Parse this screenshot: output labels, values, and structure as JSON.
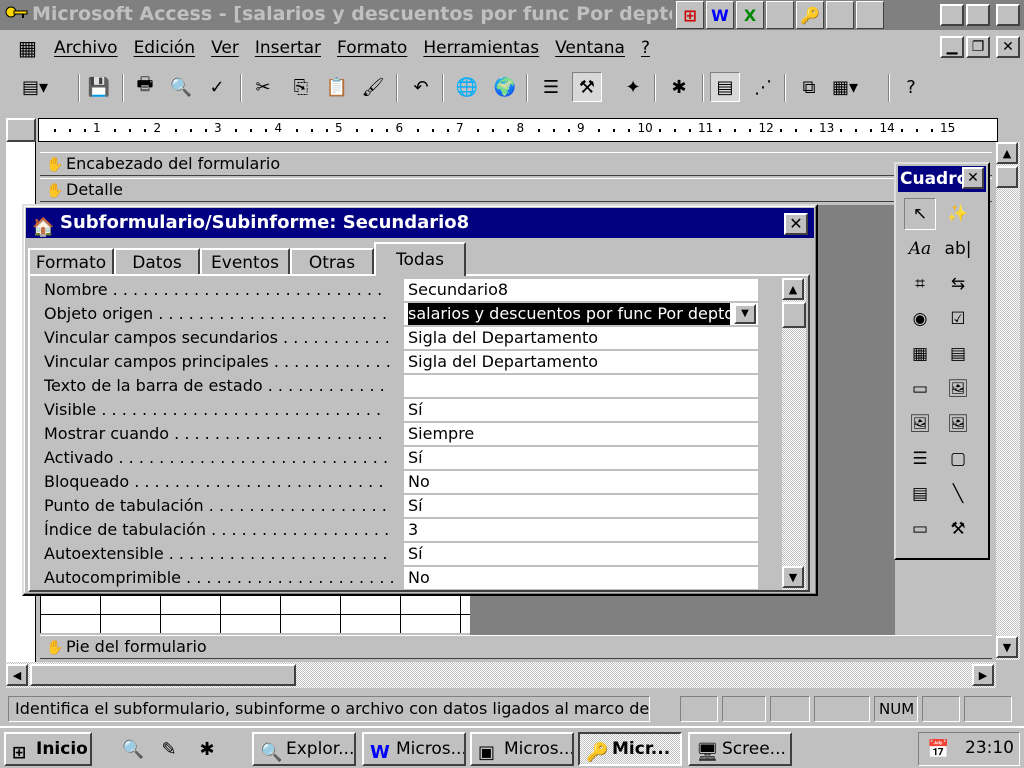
{
  "window": {
    "title": "Microsoft Access - [salarios y descuentos por func Por depto (prin) : Fo",
    "min": "▁",
    "max": "❐",
    "close": "✕"
  },
  "menubar": {
    "items": [
      {
        "label": "Archivo"
      },
      {
        "label": "Edición"
      },
      {
        "label": "Ver"
      },
      {
        "label": "Insertar"
      },
      {
        "label": "Formato"
      },
      {
        "label": "Herramientas"
      },
      {
        "label": "Ventana"
      },
      {
        "label": "?"
      }
    ]
  },
  "ruler": {
    "marks": [
      "1",
      "2",
      "3",
      "4",
      "5",
      "6",
      "7",
      "8",
      "9",
      "10",
      "11",
      "12",
      "13",
      "14",
      "15"
    ]
  },
  "sections": {
    "header": "Encabezado del formulario",
    "detail": "Detalle",
    "footer": "Pie del formulario"
  },
  "properties": {
    "title": "Subformulario/Subinforme: Secundario8",
    "tabs": [
      "Formato",
      "Datos",
      "Eventos",
      "Otras",
      "Todas"
    ],
    "active_tab": "Todas",
    "rows": [
      {
        "label": "Nombre . . . . . . . . . . . . . . . . . . . . . . . . . . .",
        "value": "Secundario8"
      },
      {
        "label": "Objeto origen . . . . . . . . . . . . . . . . . . . . . . .",
        "value": "salarios y descuentos por func Por depto (sec)"
      },
      {
        "label": "Vincular campos secundarios . . . . . . . . . . .",
        "value": "Sigla del Departamento"
      },
      {
        "label": "Vincular campos principales . . . . . . . . . . . .",
        "value": "Sigla del Departamento"
      },
      {
        "label": "Texto de la barra de estado . . . . . . . . . . . .",
        "value": ""
      },
      {
        "label": "Visible . . . . . . . . . . . . . . . . . . . . . . . . . . . .",
        "value": "Sí"
      },
      {
        "label": "Mostrar cuando . . . . . . . . . . . . . . . . . . . . .",
        "value": "Siempre"
      },
      {
        "label": "Activado . . . . . . . . . . . . . . . . . . . . . . . . . . .",
        "value": "Sí"
      },
      {
        "label": "Bloqueado . . . . . . . . . . . . . . . . . . . . . . . . .",
        "value": "No"
      },
      {
        "label": "Punto de tabulación . . . . . . . . . . . . . . . . . .",
        "value": "Sí"
      },
      {
        "label": "Índice de tabulación . . . . . . . . . . . . . . . . . .",
        "value": "3"
      },
      {
        "label": "Autoextensible . . . . . . . . . . . . . . . . . . . . . .",
        "value": "Sí"
      },
      {
        "label": "Autocomprimible . . . . . . . . . . . . . . . . . . . . .",
        "value": "No"
      }
    ]
  },
  "toolbox": {
    "title": "Cuadro",
    "tools": [
      "↖",
      "✨",
      "Aa",
      "ab|",
      "⌗",
      "⇆",
      "◉",
      "☑",
      "▦",
      "▤",
      "▭",
      "🖼",
      "🖼",
      "🖼",
      "☰",
      "▢",
      "▤",
      "╲",
      "▭",
      "⚒"
    ]
  },
  "statusbar": {
    "message": "Identifica el subformulario, subinforme o archivo con datos ligados al marco de obj",
    "num": "NUM"
  },
  "taskbar": {
    "start": "Inicio",
    "tasks": [
      {
        "label": "Explor...",
        "icon": "🔍"
      },
      {
        "label": "Micros...",
        "icon": "W"
      },
      {
        "label": "Micros...",
        "icon": "▣"
      },
      {
        "label": "Micr...",
        "icon": "🔑"
      },
      {
        "label": "Scree...",
        "icon": "🖥"
      }
    ],
    "clock": "23:10"
  }
}
